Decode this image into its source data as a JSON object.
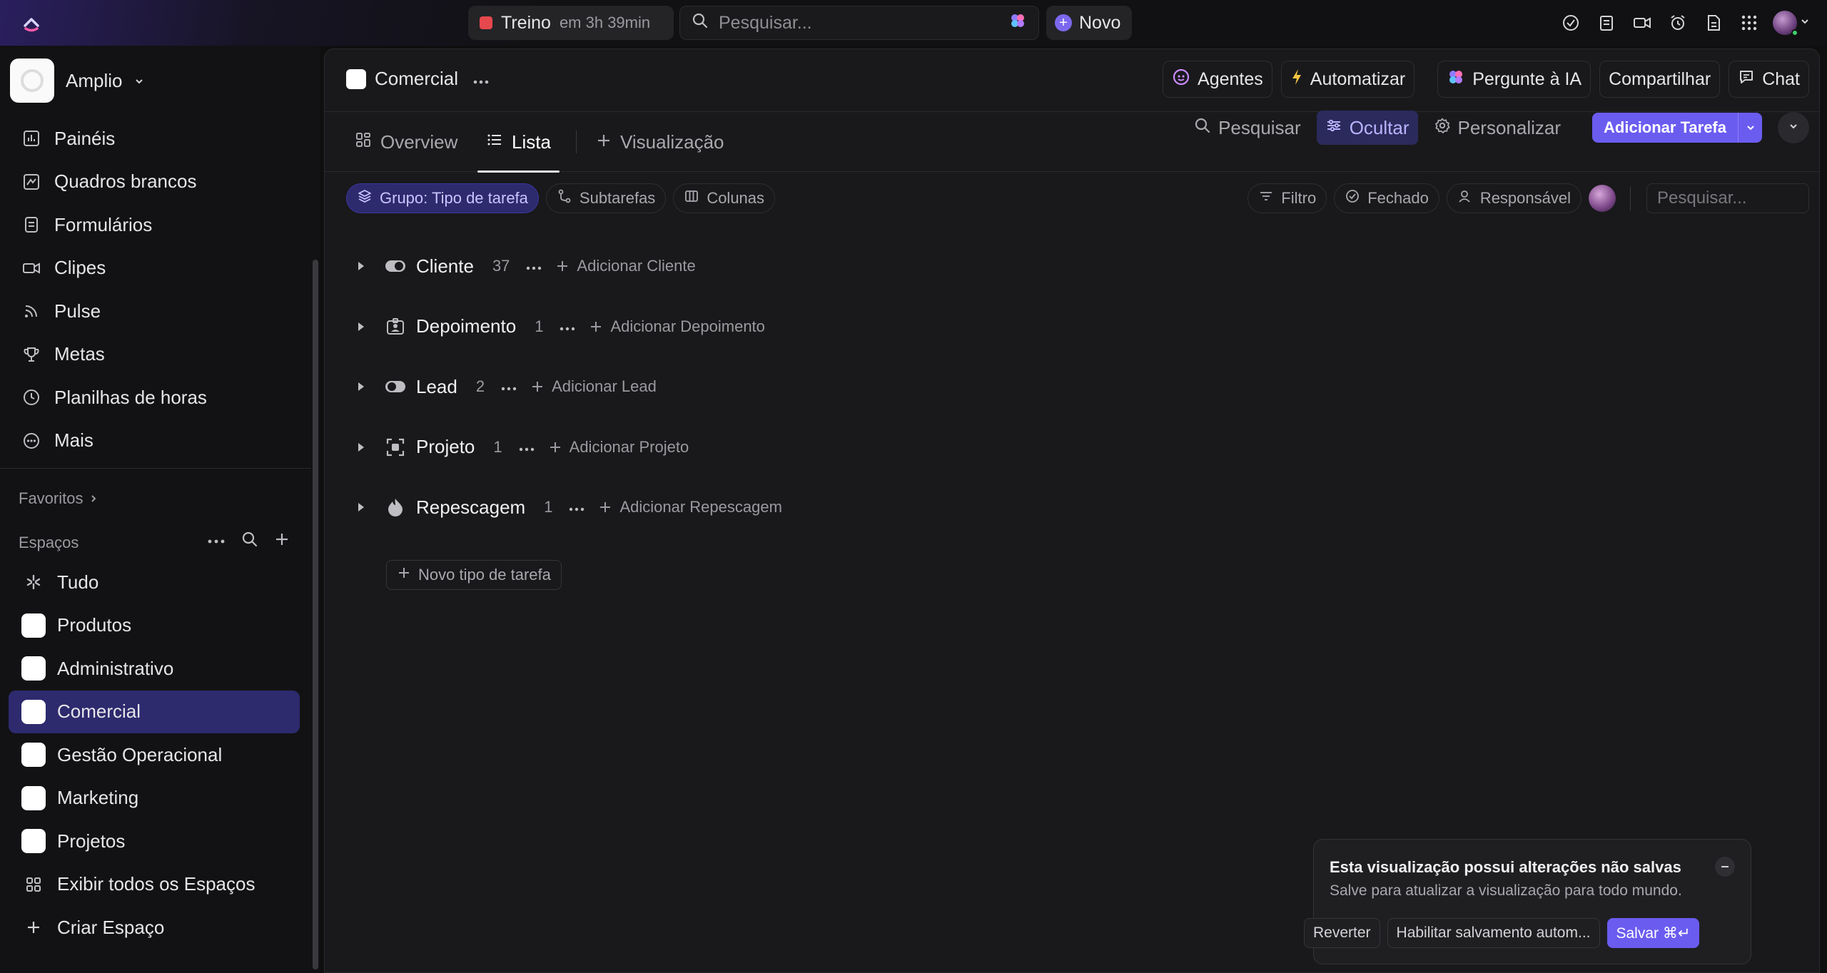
{
  "topbar": {
    "timer": {
      "label": "Treino",
      "time": "em 3h 39min"
    },
    "search_placeholder": "Pesquisar...",
    "new_label": "Novo"
  },
  "sidebar": {
    "workspace_name": "Amplio",
    "nav": [
      {
        "label": "Painéis",
        "icon": "dashboard-icon"
      },
      {
        "label": "Quadros brancos",
        "icon": "whiteboard-icon"
      },
      {
        "label": "Formulários",
        "icon": "form-icon"
      },
      {
        "label": "Clipes",
        "icon": "video-icon"
      },
      {
        "label": "Pulse",
        "icon": "pulse-icon"
      },
      {
        "label": "Metas",
        "icon": "trophy-icon"
      },
      {
        "label": "Planilhas de horas",
        "icon": "clock-icon"
      },
      {
        "label": "Mais",
        "icon": "more-icon"
      }
    ],
    "favorites_label": "Favoritos",
    "spaces_label": "Espaços",
    "spaces": [
      {
        "label": "Tudo",
        "kind": "all"
      },
      {
        "label": "Produtos",
        "kind": "space"
      },
      {
        "label": "Administrativo",
        "kind": "space"
      },
      {
        "label": "Comercial",
        "kind": "space",
        "active": true
      },
      {
        "label": "Gestão Operacional",
        "kind": "space"
      },
      {
        "label": "Marketing",
        "kind": "space"
      },
      {
        "label": "Projetos",
        "kind": "space"
      },
      {
        "label": "Exibir todos os Espaços",
        "kind": "grid"
      },
      {
        "label": "Criar Espaço",
        "kind": "plus"
      }
    ]
  },
  "page": {
    "title": "Comercial",
    "actions": {
      "agents": "Agentes",
      "automate": "Automatizar",
      "ask_ai": "Pergunte à IA",
      "share": "Compartilhar",
      "chat": "Chat"
    },
    "tabs": {
      "overview": "Overview",
      "list": "Lista",
      "view": "Visualização"
    },
    "tools": {
      "search": "Pesquisar",
      "hide": "Ocultar",
      "customize": "Personalizar",
      "add_task": "Adicionar Tarefa"
    },
    "chips": {
      "group": "Grupo: Tipo de tarefa",
      "subtasks": "Subtarefas",
      "columns": "Colunas",
      "filter": "Filtro",
      "closed": "Fechado",
      "assignee": "Responsável"
    },
    "list_search_placeholder": "Pesquisar...",
    "groups": [
      {
        "name": "Cliente",
        "count": "37",
        "add": "Adicionar Cliente",
        "icon": "toggle-icon"
      },
      {
        "name": "Depoimento",
        "count": "1",
        "add": "Adicionar Depoimento",
        "icon": "id-card-icon"
      },
      {
        "name": "Lead",
        "count": "2",
        "add": "Adicionar Lead",
        "icon": "toggle-off-icon"
      },
      {
        "name": "Projeto",
        "count": "1",
        "add": "Adicionar Projeto",
        "icon": "frame-icon"
      },
      {
        "name": "Repescagem",
        "count": "1",
        "add": "Adicionar Repescagem",
        "icon": "flame-icon"
      }
    ],
    "new_task_type": "Novo tipo de tarefa"
  },
  "toast": {
    "title": "Esta visualização possui alterações não salvas",
    "subtitle": "Salve para atualizar a visualização para todo mundo.",
    "revert": "Reverter",
    "autosave": "Habilitar salvamento autom...",
    "save": "Salvar ⌘↵"
  },
  "colors": {
    "accent": "#6b5cf0",
    "active_space": "#2d2a6e",
    "background": "#0f0f10"
  }
}
